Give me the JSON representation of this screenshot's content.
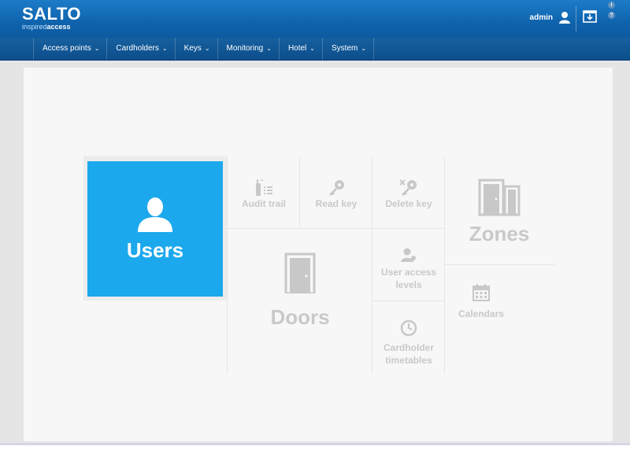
{
  "header": {
    "logo_main": "SALTO",
    "logo_tag_light": "inspired",
    "logo_tag_bold": "access",
    "user_name": "admin",
    "download_icon": "download-icon",
    "info_icon": "info-icon",
    "help_icon": "help-icon",
    "info_glyph": "i",
    "help_glyph": "?"
  },
  "nav": {
    "items": [
      {
        "label": "Access points"
      },
      {
        "label": "Cardholders"
      },
      {
        "label": "Keys"
      },
      {
        "label": "Monitoring"
      },
      {
        "label": "Hotel"
      },
      {
        "label": "System"
      }
    ],
    "chevron": "⌄"
  },
  "dashboard": {
    "users": "Users",
    "audit_trail": "Audit trail",
    "read_key": "Read key",
    "delete_key": "Delete key",
    "zones": "Zones",
    "doors": "Doors",
    "user_access_levels": "User access levels",
    "calendars": "Calendars",
    "cardholder_timetables": "Cardholder timetables"
  },
  "colors": {
    "header_blue": "#0f63ad",
    "nav_blue": "#0c4e8c",
    "tile_active": "#1ca8ec",
    "tile_inactive_text": "#c9c9c9"
  }
}
